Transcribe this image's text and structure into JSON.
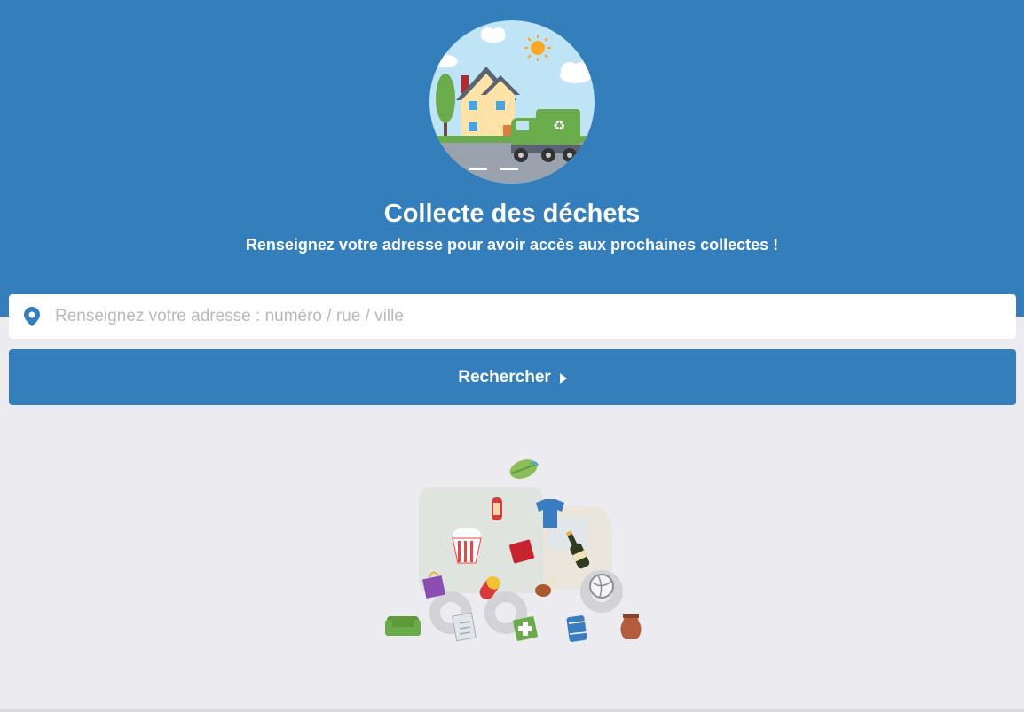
{
  "hero": {
    "title": "Collecte des déchets",
    "subtitle": "Renseignez votre adresse pour avoir accès aux prochaines collectes !",
    "illustration": "house-garbage-truck-illustration"
  },
  "search": {
    "icon": "map-pin-icon",
    "placeholder": "Renseignez votre adresse : numéro / rue / ville",
    "value": ""
  },
  "search_button": {
    "label": "Rechercher",
    "icon": "caret-right-icon"
  },
  "empty_state": {
    "illustration": "truck-with-waste-items-illustration"
  },
  "colors": {
    "primary": "#337ebb",
    "background": "#ececf0",
    "white": "#ffffff",
    "placeholder": "#b9b9b9"
  }
}
